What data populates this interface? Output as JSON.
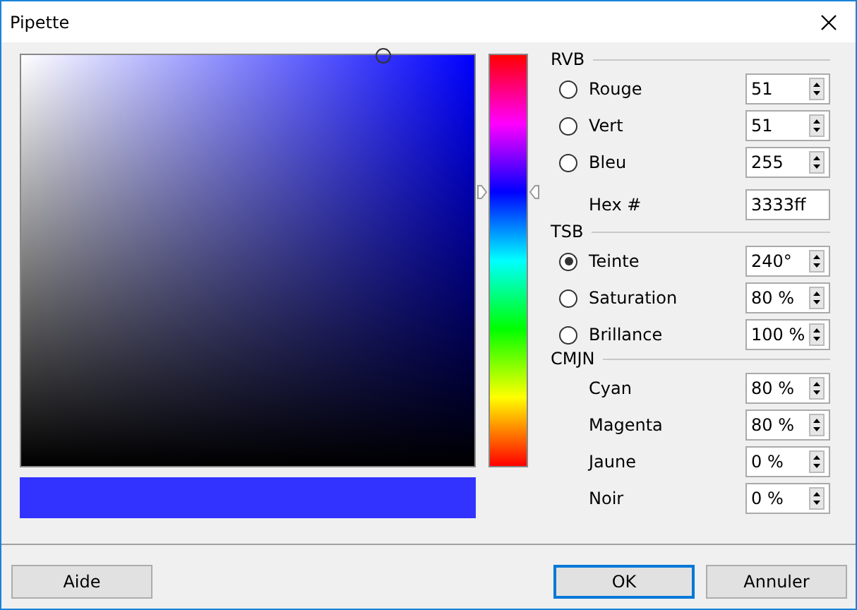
{
  "window": {
    "title": "Pipette"
  },
  "hue_bar": {
    "level": 0.667
  },
  "preview": {
    "color": "#3333ff"
  },
  "sections": [
    {
      "heading": "RVB",
      "rows": [
        {
          "kind": "radio",
          "label": "Rouge",
          "selected": false,
          "value": "51"
        },
        {
          "kind": "radio",
          "label": "Vert",
          "selected": false,
          "value": "51"
        },
        {
          "kind": "radio",
          "label": "Bleu",
          "selected": false,
          "value": "255"
        },
        {
          "kind": "text",
          "label": "Hex #",
          "value": "3333ff"
        }
      ]
    },
    {
      "heading": "TSB",
      "rows": [
        {
          "kind": "radio",
          "label": "Teinte",
          "selected": true,
          "value": "240°"
        },
        {
          "kind": "radio",
          "label": "Saturation",
          "selected": false,
          "value": "80 %"
        },
        {
          "kind": "radio",
          "label": "Brillance",
          "selected": false,
          "value": "100 %"
        }
      ]
    },
    {
      "heading": "CMJN",
      "rows": [
        {
          "kind": "plain",
          "label": "Cyan",
          "value": "80 %"
        },
        {
          "kind": "plain",
          "label": "Magenta",
          "value": "80 %"
        },
        {
          "kind": "plain",
          "label": "Jaune",
          "value": "0 %"
        },
        {
          "kind": "plain",
          "label": "Noir",
          "value": "0 %"
        }
      ]
    }
  ],
  "buttons": [
    {
      "label": "Aide",
      "default": false
    },
    {
      "label": "OK",
      "default": true
    },
    {
      "label": "Annuler",
      "default": false
    }
  ]
}
